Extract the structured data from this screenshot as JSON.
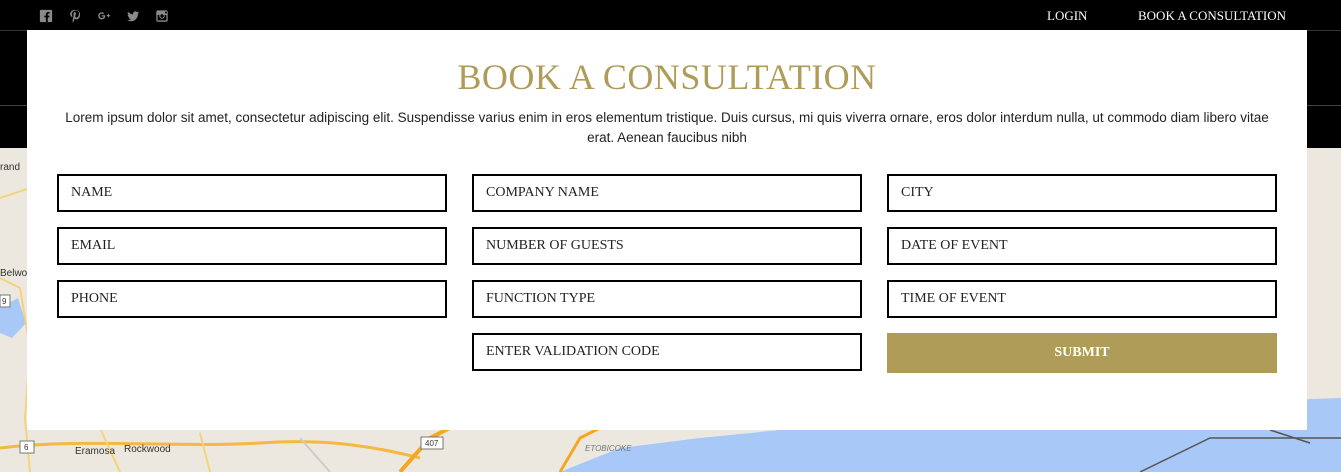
{
  "topbar": {
    "social_icons": [
      "facebook-icon",
      "pinterest-icon",
      "google-plus-icon",
      "twitter-icon",
      "instagram-icon"
    ],
    "login_label": "LOGIN",
    "book_label": "BOOK A CONSULTATION"
  },
  "modal": {
    "title": "BOOK A CONSULTATION",
    "description": "Lorem ipsum dolor sit amet, consectetur adipiscing elit. Suspendisse varius enim in eros elementum tristique. Duis cursus, mi quis viverra ornare, eros dolor interdum nulla, ut commodo diam libero vitae erat. Aenean faucibus nibh",
    "fields": {
      "name": "NAME",
      "email": "EMAIL",
      "phone": "PHONE",
      "company": "COMPANY NAME",
      "guests": "NUMBER OF GUESTS",
      "function_type": "FUNCTION TYPE",
      "validation": "ENTER VALIDATION CODE",
      "city": "CITY",
      "date": "DATE OF EVENT",
      "time": "TIME OF EVENT"
    },
    "submit_label": "SUBMIT"
  },
  "map": {
    "labels": {
      "brand": "rand",
      "belwood": "Belwo",
      "eramosa": "Eramosa",
      "rockwood": "Rockwood",
      "etobicoke": "ETOBICOKE",
      "hwy407": "407",
      "hwy6": "6",
      "hwy9": "9"
    }
  },
  "colors": {
    "accent": "#b09c59",
    "black": "#000000",
    "water": "#a8c8f8"
  }
}
